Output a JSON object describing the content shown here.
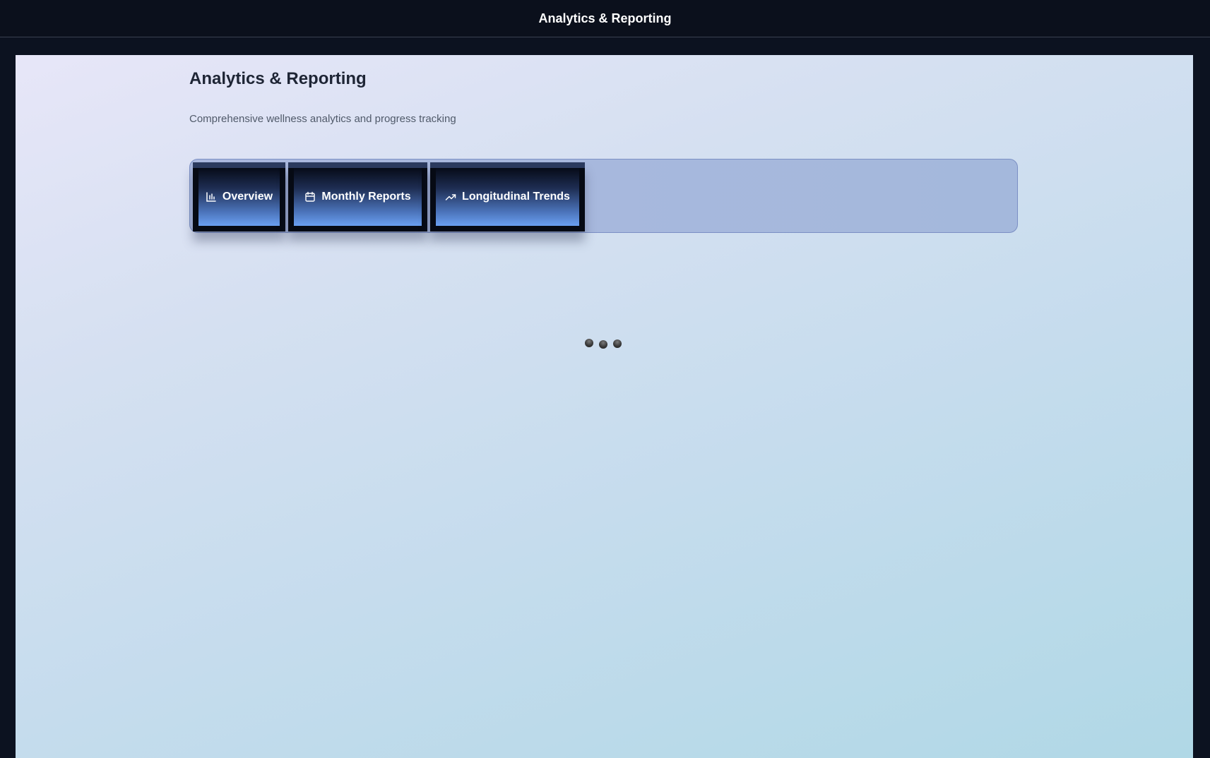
{
  "app": {
    "window_title": "Analytics & Reporting"
  },
  "page": {
    "title": "Analytics & Reporting",
    "subtitle": "Comprehensive wellness analytics and progress tracking"
  },
  "tabs": [
    {
      "label": "Overview",
      "icon": "bar-chart-icon"
    },
    {
      "label": "Monthly Reports",
      "icon": "calendar-icon"
    },
    {
      "label": "Longitudinal Trends",
      "icon": "trending-up-icon"
    }
  ],
  "loader": {
    "dots": 3
  },
  "colors": {
    "topbar_bg": "#0b101c",
    "tab_bar_bg": "#a8b8de",
    "tab_accent_bottom": "#6aa0f2",
    "title_text": "#1e2535",
    "subtitle_text": "#505a6a"
  }
}
